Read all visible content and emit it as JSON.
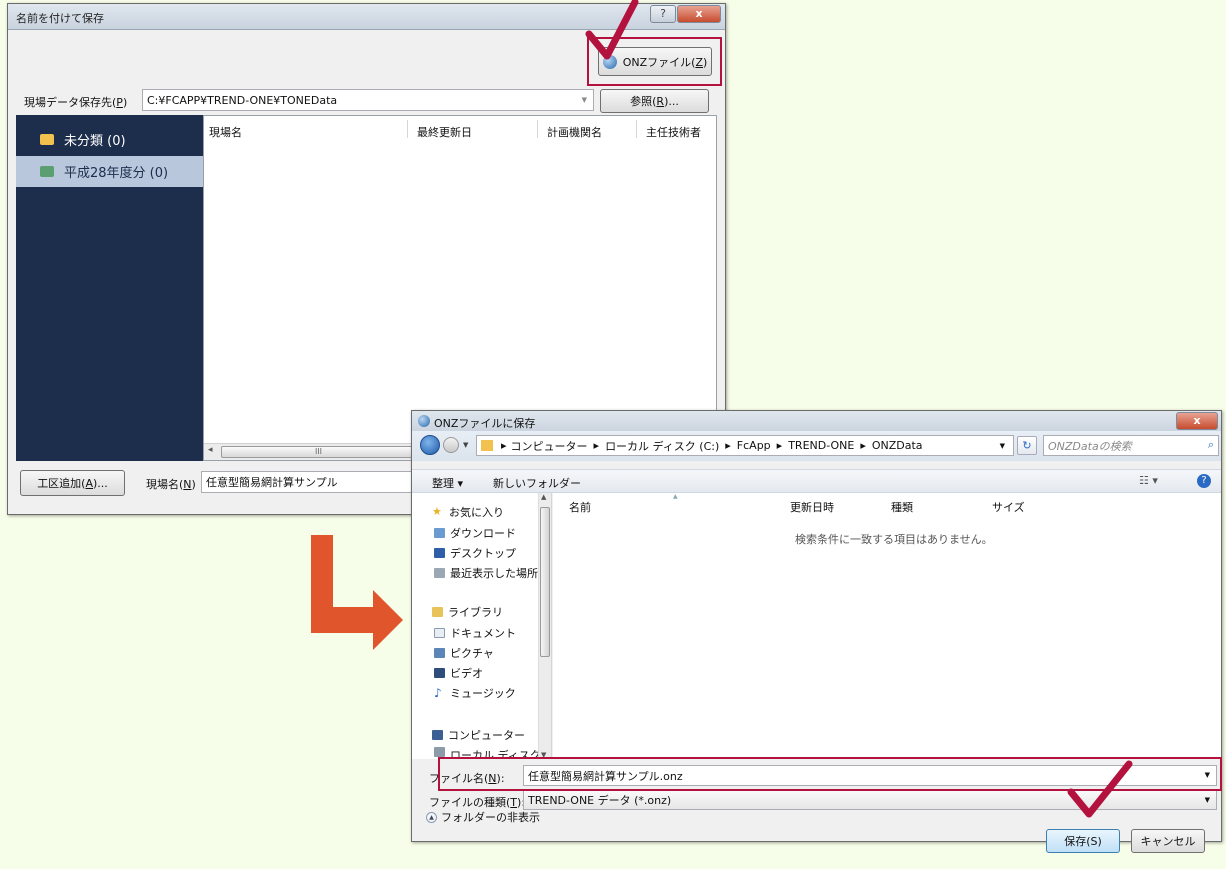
{
  "dialog1": {
    "title": "名前を付けて保存",
    "help_btn": "?",
    "close_btn": "x",
    "onz_button": {
      "prefix": "ONZファイル(",
      "key": "Z",
      "suffix": ")"
    },
    "save_dest_label": {
      "text": "現場データ保存先(",
      "key": "P",
      "suffix": ")"
    },
    "save_dest_value": "C:¥FCAPP¥TREND-ONE¥TONEData",
    "browse_button": {
      "text": "参照(",
      "key": "R",
      "suffix": ")..."
    },
    "nav_items": [
      {
        "label": "未分類 (0)",
        "selected": false
      },
      {
        "label": "平成28年度分 (0)",
        "selected": true
      }
    ],
    "columns": [
      "現場名",
      "最終更新日",
      "計画機関名",
      "主任技術者"
    ],
    "hscroll_thumb": "III",
    "add_section_button": {
      "text": "工区追加(",
      "key": "A",
      "suffix": ")..."
    },
    "site_name_label": {
      "text": "現場名(",
      "key": "N",
      "suffix": ")"
    },
    "site_name_value": "任意型簡易網計算サンプル"
  },
  "dialog2": {
    "title": "ONZファイルに保存",
    "close_btn": "x",
    "breadcrumb": [
      "コンピューター",
      "ローカル ディスク (C:)",
      "FcApp",
      "TREND-ONE",
      "ONZData"
    ],
    "search_placeholder": "ONZDataの検索",
    "toolbar": {
      "organize": "整理 ▾",
      "new_folder": "新しいフォルダー"
    },
    "sidebar": {
      "favorites": "お気に入り",
      "fav_items": [
        "ダウンロード",
        "デスクトップ",
        "最近表示した場所"
      ],
      "libraries": "ライブラリ",
      "lib_items": [
        "ドキュメント",
        "ピクチャ",
        "ビデオ",
        "ミュージック"
      ],
      "computer": "コンピューター",
      "computer_sub": "ローカル ディスク"
    },
    "columns": [
      "名前",
      "更新日時",
      "種類",
      "サイズ"
    ],
    "empty_message": "検索条件に一致する項目はありません。",
    "filename_label": {
      "text": "ファイル名(",
      "key": "N",
      "suffix": "):"
    },
    "filename_value": "任意型簡易網計算サンプル.onz",
    "filetype_label": {
      "text": "ファイルの種類(",
      "key": "T",
      "suffix": "):"
    },
    "filetype_value": "TREND-ONE データ (*.onz)",
    "hide_folders": "フォルダーの非表示",
    "save_button": "保存(S)",
    "cancel_button": "キャンセル"
  },
  "colors": {
    "background": "#f6fde8",
    "nav_dark": "#1d2d4c",
    "nav_selected": "#b9c7dd",
    "highlight_red": "#b3123e",
    "arrow_orange": "#e0552b"
  }
}
